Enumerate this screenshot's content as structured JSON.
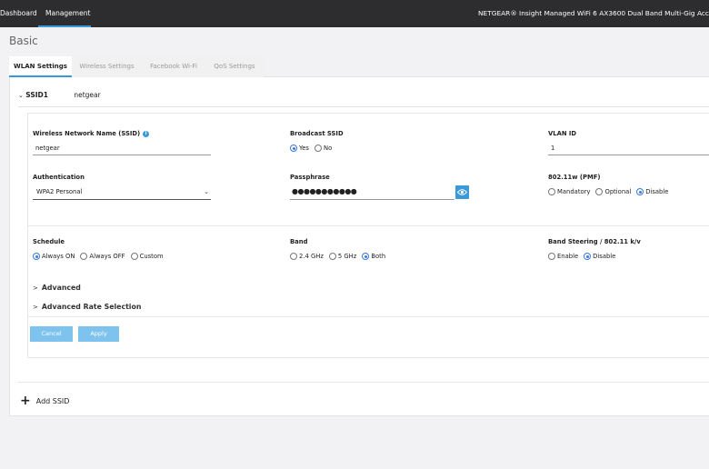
{
  "topbar": {
    "nav": [
      {
        "label": "Dashboard",
        "active": false
      },
      {
        "label": "Management",
        "active": true
      }
    ],
    "product_title": "NETGEAR® Insight Managed WiFi 6 AX3600 Dual Band Multi-Gig Acc"
  },
  "page_title": "Basic",
  "tabs": [
    {
      "label": "WLAN Settings",
      "active": true
    },
    {
      "label": "Wireless Settings",
      "active": false
    },
    {
      "label": "Facebook Wi-Fi",
      "active": false
    },
    {
      "label": "QoS Settings",
      "active": false
    }
  ],
  "ssid": {
    "id_label": "SSID1",
    "name": "netgear"
  },
  "form": {
    "ssid_name": {
      "label": "Wireless Network Name (SSID)",
      "value": "netgear"
    },
    "broadcast": {
      "label": "Broadcast SSID",
      "options": [
        "Yes",
        "No"
      ],
      "selected": "Yes"
    },
    "vlan": {
      "label": "VLAN ID",
      "value": "1"
    },
    "auth": {
      "label": "Authentication",
      "value": "WPA2 Personal"
    },
    "passphrase": {
      "label": "Passphrase",
      "masked": "●●●●●●●●●●●"
    },
    "pmf": {
      "label": "802.11w (PMF)",
      "options": [
        "Mandatory",
        "Optional",
        "Disable"
      ],
      "selected": "Disable"
    },
    "schedule": {
      "label": "Schedule",
      "options": [
        "Always ON",
        "Always OFF",
        "Custom"
      ],
      "selected": "Always ON"
    },
    "band": {
      "label": "Band",
      "options": [
        "2.4 GHz",
        "5 GHz",
        "Both"
      ],
      "selected": "Both"
    },
    "steering": {
      "label": "Band Steering / 802.11 k/v",
      "options": [
        "Enable",
        "Disable"
      ],
      "selected": "Disable"
    }
  },
  "sections": {
    "advanced": "Advanced",
    "advanced_rate": "Advanced Rate Selection"
  },
  "buttons": {
    "cancel": "Cancel",
    "apply": "Apply"
  },
  "add_ssid": "Add SSID",
  "colors": {
    "accent": "#3a9ad9",
    "button": "#7ec3ee",
    "topbar": "#2d2d2f"
  }
}
